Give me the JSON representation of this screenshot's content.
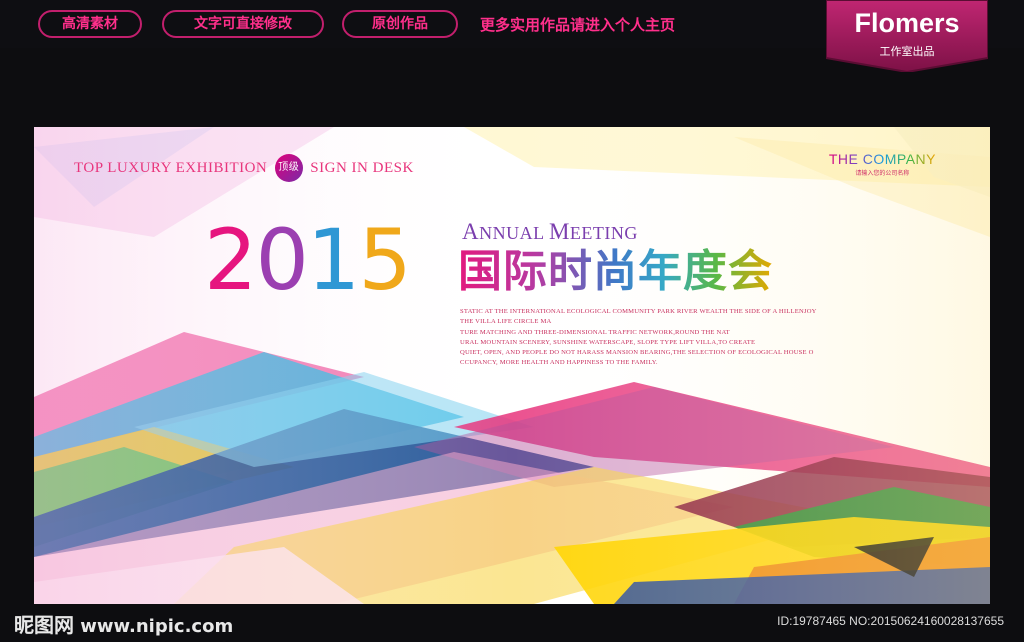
{
  "topbar": {
    "pills": [
      "高清素材",
      "文字可直接修改",
      "原创作品"
    ],
    "promo": "更多实用作品请进入个人主页"
  },
  "brand": {
    "name": "Flomers",
    "subtitle": "工作室出品",
    "color": "#a11a5e"
  },
  "banner": {
    "tag_top": "TOP LUXURY EXHIBITION",
    "tag_badge": "顶级",
    "tag_sign": "SIGN IN DESK",
    "company_name": "THE COMPANY",
    "company_sub": "请输入您的公司名称",
    "year_digits": [
      "2",
      "0",
      "1",
      "5"
    ],
    "year_colors": [
      "#e6157f",
      "#9b3fb1",
      "#2f97d4",
      "#f0a81a"
    ],
    "annual": "ANNUAL MEETING",
    "title_cn": "国际时尚年度会",
    "description_lines": [
      "STATIC AT THE INTERNATIONAL ECOLOGICAL COMMUNITY PARK RIVER WEALTH THE SIDE OF A HILLENJOY",
      "THE VILLA LIFE CIRCLE MA",
      "TURE MATCHING AND THREE-DIMENSIONAL TRAFFIC NETWORK,ROUND THE NAT",
      "URAL MOUNTAIN SCENERY, SUNSHINE WATERSCAPE, SLOPE TYPE LIFT VILLA,TO CREATE",
      "QUIET, OPEN, AND PEOPLE DO NOT HARASS MANSION BEARING,THE SELECTION OF ECOLOGICAL HOUSE O",
      "CCUPANCY, MORE HEALTH AND HAPPINESS TO THE FAMILY."
    ]
  },
  "footer": {
    "watermark_cn": "昵图网",
    "watermark_url": "www.nipic.com",
    "id_text": "ID:19787465 NO:20150624160028137655"
  }
}
